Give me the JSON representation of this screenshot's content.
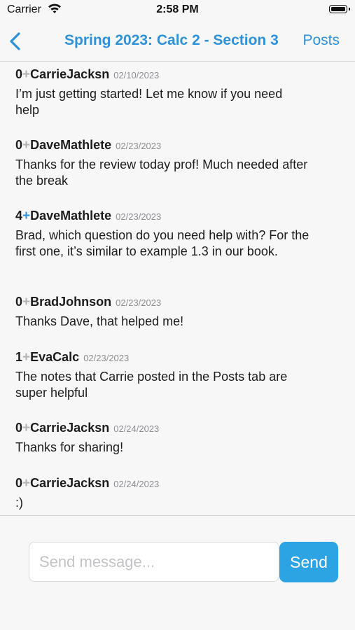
{
  "status_bar": {
    "carrier": "Carrier",
    "time": "2:58 PM",
    "icons": [
      "wifi-icon",
      "battery-icon"
    ]
  },
  "nav": {
    "back_icon": "chevron-left-icon",
    "title": "Spring 2023: Calc 2 - Section 3",
    "posts_label": "Posts",
    "accent_color": "#2f91d8"
  },
  "messages": [
    {
      "score": "0",
      "plus_active": false,
      "author": "CarrieJacksn",
      "date": "02/10/2023",
      "text": "I’m just getting started! Let me know if you need help"
    },
    {
      "score": "0",
      "plus_active": false,
      "author": "DaveMathlete",
      "date": "02/23/2023",
      "text": "Thanks for the review today prof! Much needed after the break"
    },
    {
      "score": "4",
      "plus_active": true,
      "author": "DaveMathlete",
      "date": "02/23/2023",
      "text": "Brad, which question do you need help with? For the first one, it’s similar to example 1.3 in our book."
    },
    {
      "score": "0",
      "plus_active": false,
      "author": "BradJohnson",
      "date": "02/23/2023",
      "text": "Thanks Dave, that helped me!"
    },
    {
      "score": "1",
      "plus_active": false,
      "author": "EvaCalc",
      "date": "02/23/2023",
      "text": "The notes that Carrie posted in the Posts tab are super helpful"
    },
    {
      "score": "0",
      "plus_active": false,
      "author": "CarrieJacksn",
      "date": "02/24/2023",
      "text": "Thanks for sharing!"
    },
    {
      "score": "0",
      "plus_active": false,
      "author": "CarrieJacksn",
      "date": "02/24/2023",
      "text": ":)"
    }
  ],
  "plus_symbol": "+",
  "composer": {
    "placeholder": "Send message...",
    "value": "",
    "send_label": "Send",
    "send_color": "#2ca4e4"
  }
}
